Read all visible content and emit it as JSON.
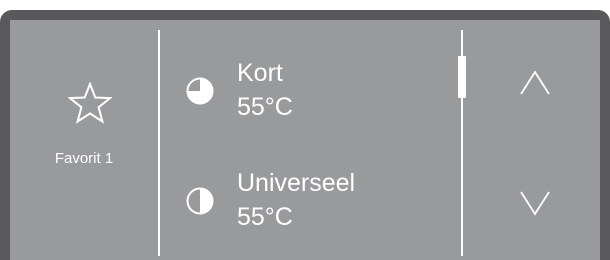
{
  "favorite": {
    "label": "Favorit 1",
    "icon": "star-outline-icon"
  },
  "programs": [
    {
      "name": "Kort",
      "temp": "55°C",
      "icon": "pie-three-quarter-icon"
    },
    {
      "name": "Universeel",
      "temp": "55°C",
      "icon": "pie-half-icon"
    }
  ],
  "navigation": {
    "up_icon": "chevron-up-icon",
    "down_icon": "chevron-down-icon"
  },
  "scroll": {
    "position_fraction": 0.0
  },
  "colors": {
    "bezel": "#59595b",
    "screen": "#999a9c",
    "foreground": "#ffffff"
  }
}
